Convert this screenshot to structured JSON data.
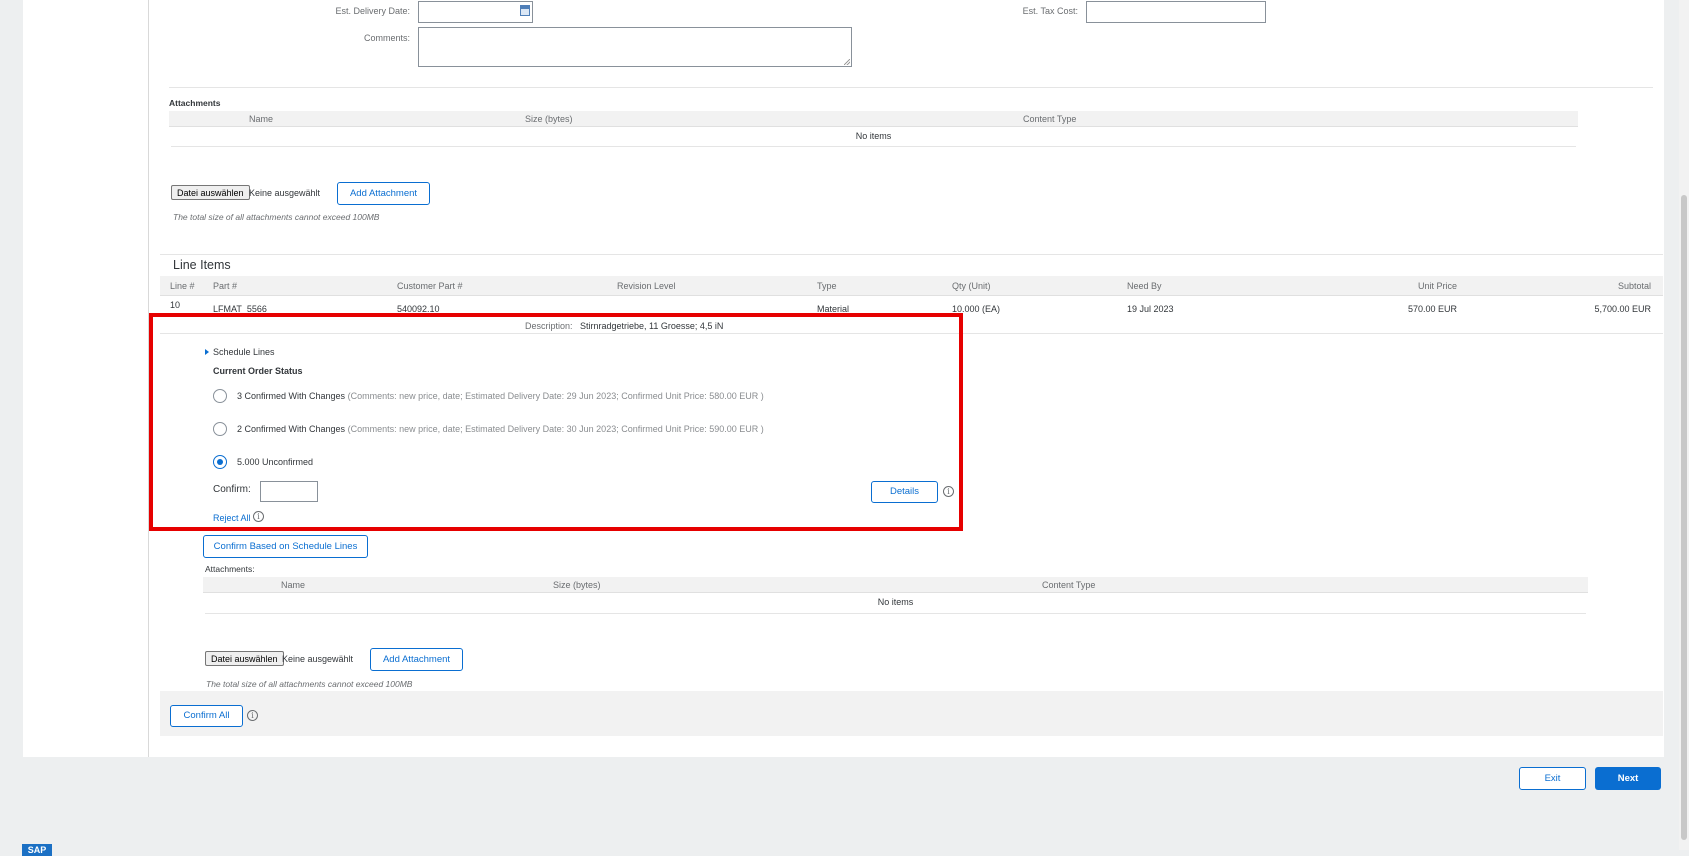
{
  "header_form": {
    "delivery_date_label": "Est. Delivery Date:",
    "delivery_date_value": "",
    "comments_label": "Comments:",
    "comments_value": "",
    "tax_cost_label": "Est. Tax Cost:",
    "tax_cost_value": ""
  },
  "attachments": {
    "title": "Attachments",
    "columns": [
      "Name",
      "Size (bytes)",
      "Content Type"
    ],
    "empty_text": "No items",
    "choose_file_label": "Datei auswählen",
    "no_file_text": "Keine ausgewählt",
    "add_label": "Add Attachment",
    "size_hint": "The total size of all attachments cannot exceed 100MB"
  },
  "line_items": {
    "title": "Line Items",
    "columns": [
      "Line #",
      "Part #",
      "Customer Part #",
      "Revision Level",
      "Type",
      "Qty (Unit)",
      "Need By",
      "Unit Price",
      "Subtotal"
    ],
    "rows": [
      {
        "line": "10",
        "part": "LFMAT_5566",
        "customer_part": "540092.10",
        "revision": "",
        "type": "Material",
        "qty": "10.000 (EA)",
        "need_by": "19 Jul 2023",
        "unit_price": "570.00 EUR",
        "subtotal": "5,700.00 EUR",
        "description_label": "Description:",
        "description": "Stirnradgetriebe, 11 Groesse; 4,5 iN"
      }
    ]
  },
  "schedule": {
    "toggle_label": "Schedule Lines",
    "status_title": "Current Order Status",
    "options": [
      {
        "label": "3 Confirmed With Changes",
        "detail": "(Comments: new price, date; Estimated Delivery Date: 29 Jun 2023; Confirmed Unit Price: 580.00 EUR )",
        "checked": false
      },
      {
        "label": "2 Confirmed With Changes",
        "detail": "(Comments: new price, date; Estimated Delivery Date: 30 Jun 2023; Confirmed Unit Price: 590.00 EUR )",
        "checked": false
      },
      {
        "label": "5.000 Unconfirmed",
        "detail": "",
        "checked": true
      }
    ],
    "confirm_label": "Confirm:",
    "confirm_value": "",
    "details_label": "Details",
    "reject_all_label": "Reject All",
    "confirm_schedule_label": "Confirm Based on Schedule Lines"
  },
  "line_attachments": {
    "title": "Attachments:",
    "columns": [
      "Name",
      "Size (bytes)",
      "Content Type"
    ],
    "empty_text": "No items",
    "choose_file_label": "Datei auswählen",
    "no_file_text": "Keine ausgewählt",
    "add_label": "Add Attachment",
    "size_hint": "The total size of all attachments cannot exceed 100MB"
  },
  "footer": {
    "confirm_all_label": "Confirm All",
    "exit_label": "Exit",
    "next_label": "Next",
    "logo_text": "SAP"
  },
  "colors": {
    "accent": "#0a6ed1",
    "highlight": "#e60000",
    "background": "#edeff0"
  }
}
